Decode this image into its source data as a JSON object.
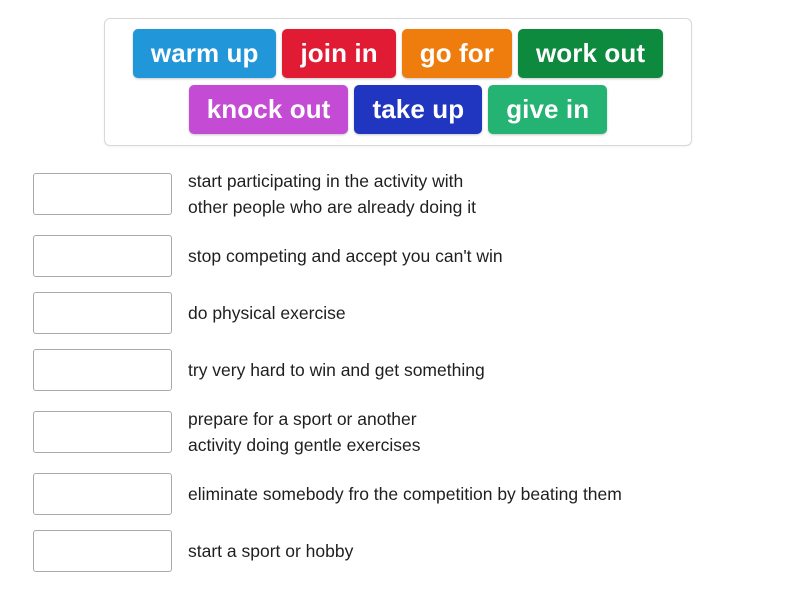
{
  "activity": {
    "type": "matching-drag-and-drop",
    "background_color": "#ffffff"
  },
  "word_bank": {
    "border_color": "#d8d8d8",
    "rows": [
      [
        {
          "label": "warm up",
          "color": "#2196d9",
          "name": "tile-warm-up"
        },
        {
          "label": "join in",
          "color": "#e01b33",
          "name": "tile-join-in"
        },
        {
          "label": "go for",
          "color": "#ef7d0d",
          "name": "tile-go-for"
        },
        {
          "label": "work out",
          "color": "#0d8a3e",
          "name": "tile-work-out"
        }
      ],
      [
        {
          "label": "knock out",
          "color": "#c44bd4",
          "name": "tile-knock-out"
        },
        {
          "label": "take up",
          "color": "#2035c0",
          "name": "tile-take-up"
        },
        {
          "label": "give in",
          "color": "#24b373",
          "name": "tile-give-in"
        }
      ]
    ]
  },
  "answer_rows": [
    {
      "answer": "",
      "definition": "start participating in the activity with\nother people who are already doing it"
    },
    {
      "answer": "",
      "definition": "stop competing and accept you can't win"
    },
    {
      "answer": "",
      "definition": "do physical exercise"
    },
    {
      "answer": "",
      "definition": "try very hard to win and get something"
    },
    {
      "answer": "",
      "definition": "prepare for a sport or another\nactivity doing gentle exercises"
    },
    {
      "answer": "",
      "definition": "eliminate somebody fro the competition by beating them"
    },
    {
      "answer": "",
      "definition": "start a sport or hobby"
    }
  ]
}
